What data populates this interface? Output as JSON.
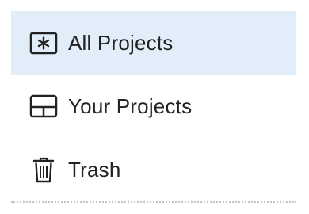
{
  "sidebar": {
    "items": [
      {
        "label": "All Projects",
        "icon": "asterisk-box-icon",
        "selected": true
      },
      {
        "label": "Your Projects",
        "icon": "grid-box-icon",
        "selected": false
      },
      {
        "label": "Trash",
        "icon": "trash-icon",
        "selected": false
      }
    ]
  },
  "colors": {
    "selected_background": "#e1eef9",
    "text": "#222222",
    "divider": "#c4c4c4"
  }
}
